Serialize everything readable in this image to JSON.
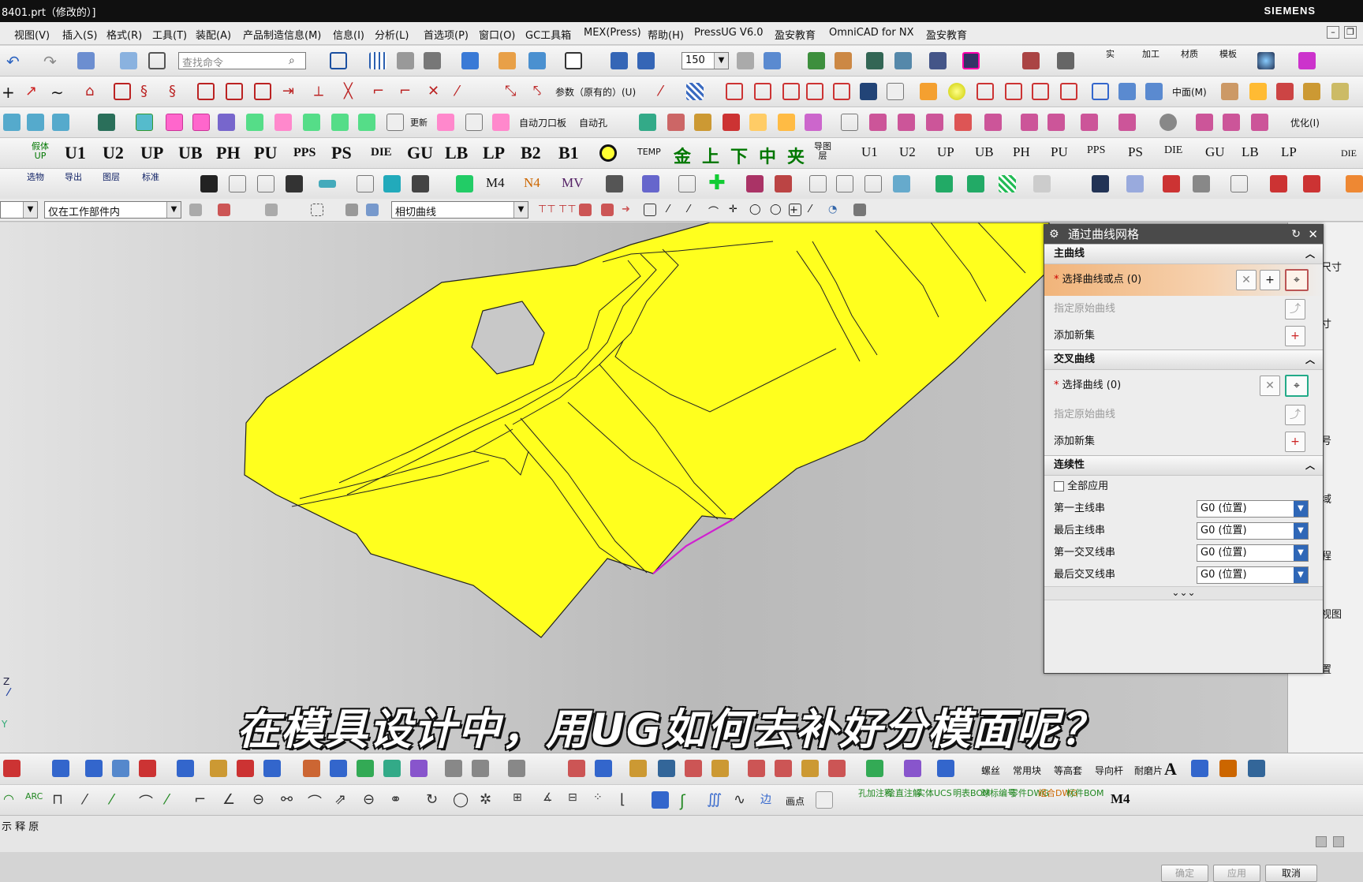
{
  "window": {
    "title": "8401.prt（修改的）]",
    "brand": "SIEMENS"
  },
  "menu": [
    "视图(V)",
    "插入(S)",
    "格式(R)",
    "工具(T)",
    "装配(A)",
    "产品制造信息(M)",
    "信息(I)",
    "分析(L)",
    "首选项(P)",
    "窗口(O)",
    "GC工具箱",
    "MEX(Press)",
    "帮助(H)",
    "PressUG V6.0",
    "盈安教育",
    "OmniCAD for NX",
    "盈安教育"
  ],
  "toolbar1": {
    "search_placeholder": "查找命令",
    "zoom_value": "150",
    "labels": [
      "实",
      "加工",
      "材质",
      "模板"
    ]
  },
  "toolbar2": {
    "labels": [
      "参数（原有的）(U)",
      "中面(M)"
    ]
  },
  "toolbar3": {
    "labels": [
      "自动刀口板",
      "自动孔",
      "优化(I)",
      "更新"
    ]
  },
  "toolbar4": {
    "codes": [
      "U1",
      "U2",
      "UP",
      "UB",
      "PH",
      "PU",
      "PPS",
      "PS",
      "DIE",
      "GU",
      "LB",
      "LP",
      "B2",
      "B1"
    ],
    "marks": [
      "金",
      "上",
      "下",
      "中",
      "夹"
    ],
    "small_codes": [
      "U1",
      "U2",
      "UP",
      "UB",
      "PH",
      "PU",
      "PPS",
      "PS",
      "DIE",
      "GU",
      "LB",
      "LP"
    ],
    "extra": [
      "TEMP",
      "DIE"
    ]
  },
  "toolbar5": {
    "labels": [
      "选物",
      "导出",
      "图层",
      "标准",
      "M4",
      "N4",
      "MV"
    ]
  },
  "selectionbar": {
    "filter": "仅在工作部件内",
    "curve_rule": "相切曲线"
  },
  "dialog": {
    "title": "通过曲线网格",
    "primary": {
      "header": "主曲线",
      "select": "选择曲线或点 (0)",
      "specify": "指定原始曲线",
      "add": "添加新集"
    },
    "cross": {
      "header": "交叉曲线",
      "select": "选择曲线 (0)",
      "specify": "指定原始曲线",
      "add": "添加新集"
    },
    "continuity": {
      "header": "连续性",
      "apply_all": "全部应用",
      "rows": [
        {
          "label": "第一主线串",
          "value": "G0 (位置)"
        },
        {
          "label": "最后主线串",
          "value": "G0 (位置)"
        },
        {
          "label": "第一交叉线串",
          "value": "G0 (位置)"
        },
        {
          "label": "最后交叉线串",
          "value": "G0 (位置)"
        }
      ]
    },
    "buttons": {
      "ok": "确定",
      "apply": "应用",
      "cancel": "取消"
    }
  },
  "right_panel": [
    "尺寸",
    "寸",
    "号",
    "域",
    "程",
    "视图",
    "置"
  ],
  "bottombar1": {
    "labels": [
      "螺丝",
      "常用块",
      "等高套",
      "导向杆",
      "耐磨片",
      "A"
    ]
  },
  "bottombar2": {
    "labels": [
      "画点",
      "孔加注释",
      "绘直注解",
      "实体UCS",
      "明表BOM",
      "球标编号",
      "零件DWG",
      "组合DWG",
      "标件BOM",
      "M4"
    ]
  },
  "statusbar": {
    "text": "示 释 原"
  },
  "subtitle": "在模具设计中，用UG如何去补好分模面呢？",
  "colors": {
    "part": "#ffff1e",
    "highlight": "#d020d0",
    "dialog_header": "#4a4a4a"
  }
}
